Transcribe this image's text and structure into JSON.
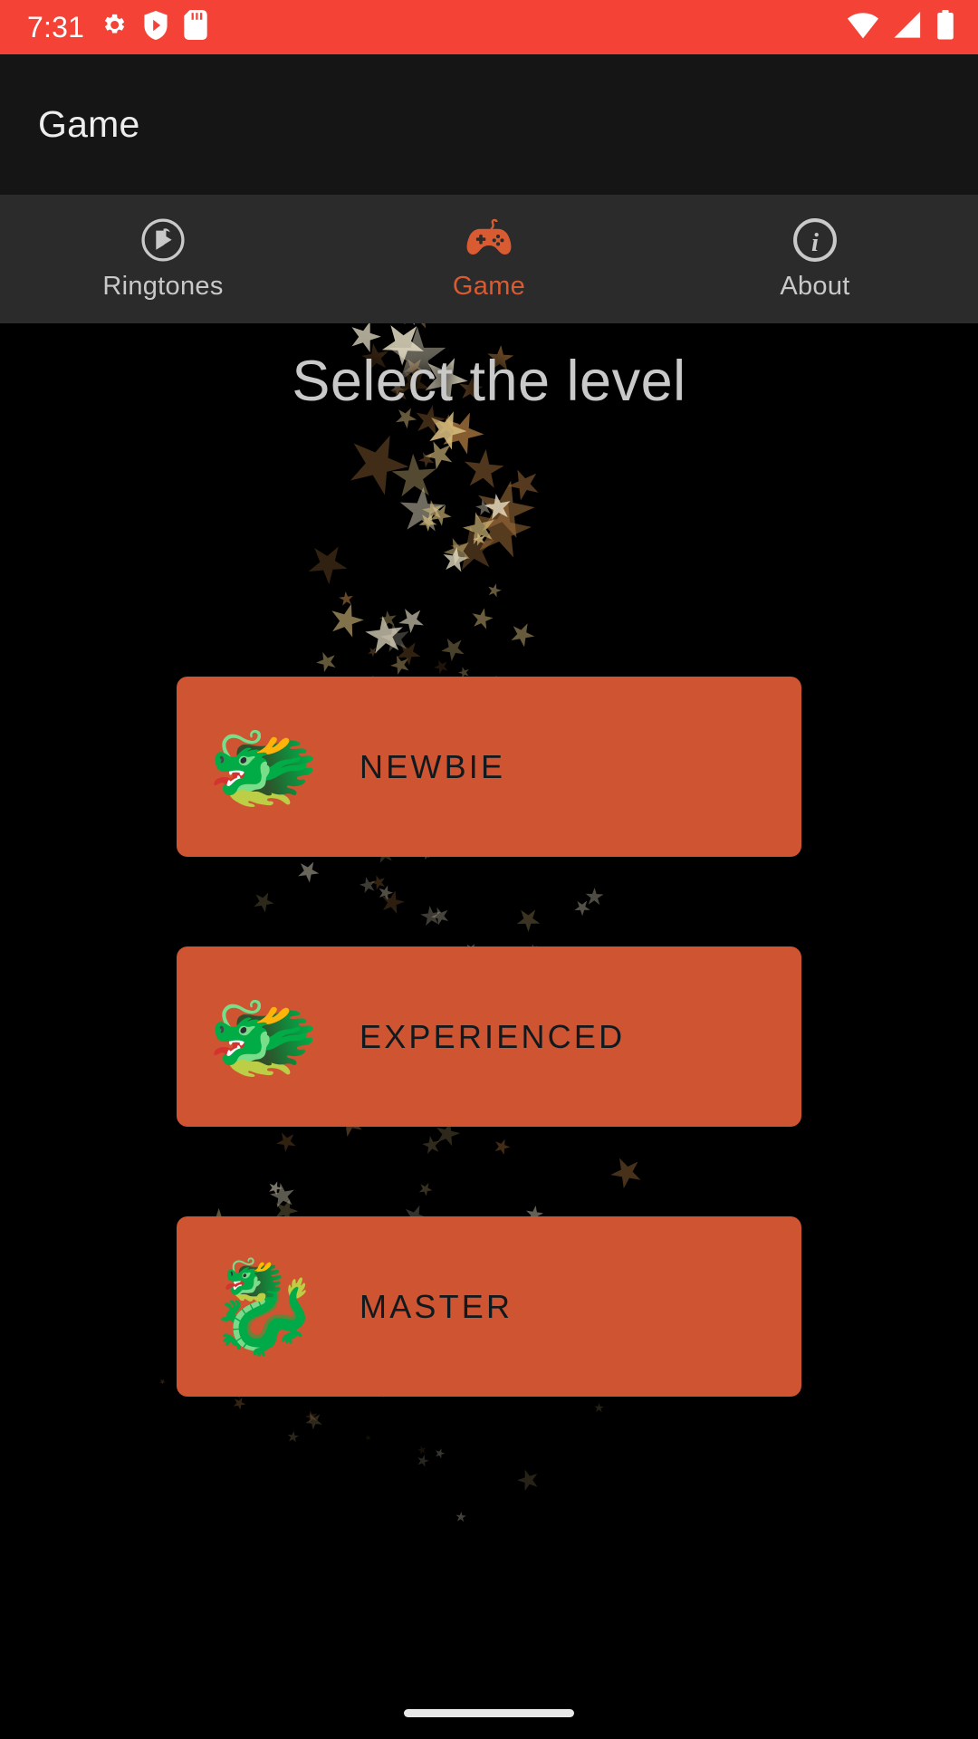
{
  "status_bar": {
    "time": "7:31",
    "background": "#F44336",
    "left_icons": [
      "gear-icon",
      "shield-play-icon",
      "sd-card-icon"
    ],
    "right_icons": [
      "wifi-icon",
      "cell-signal-icon",
      "battery-icon"
    ]
  },
  "app_bar": {
    "title": "Game",
    "background": "#151515"
  },
  "tabs": {
    "active_index": 1,
    "active_color": "#D95B31",
    "inactive_color": "#C9C9C9",
    "background": "#2B2B2B",
    "items": [
      {
        "label": "Ringtones",
        "icon": "ringtone-play-circle-icon",
        "active": false
      },
      {
        "label": "Game",
        "icon": "gamepad-icon",
        "active": true
      },
      {
        "label": "About",
        "icon": "info-circle-icon",
        "active": false
      }
    ]
  },
  "main": {
    "heading": "Select the level",
    "heading_color": "#C9C9C9",
    "background": "#000000",
    "button_color": "#CF5431",
    "button_text_color": "#101A1E",
    "levels": [
      {
        "label": "NEWBIE",
        "emoji": "🐲",
        "icon": "dragon-fruit-icon"
      },
      {
        "label": "EXPERIENCED",
        "emoji": "🐲",
        "icon": "dragon-face-icon"
      },
      {
        "label": "MASTER",
        "emoji": "🐉",
        "icon": "dragon-icon"
      }
    ]
  },
  "nav_bar": {
    "gesture_pill": "home-gesture-pill"
  }
}
